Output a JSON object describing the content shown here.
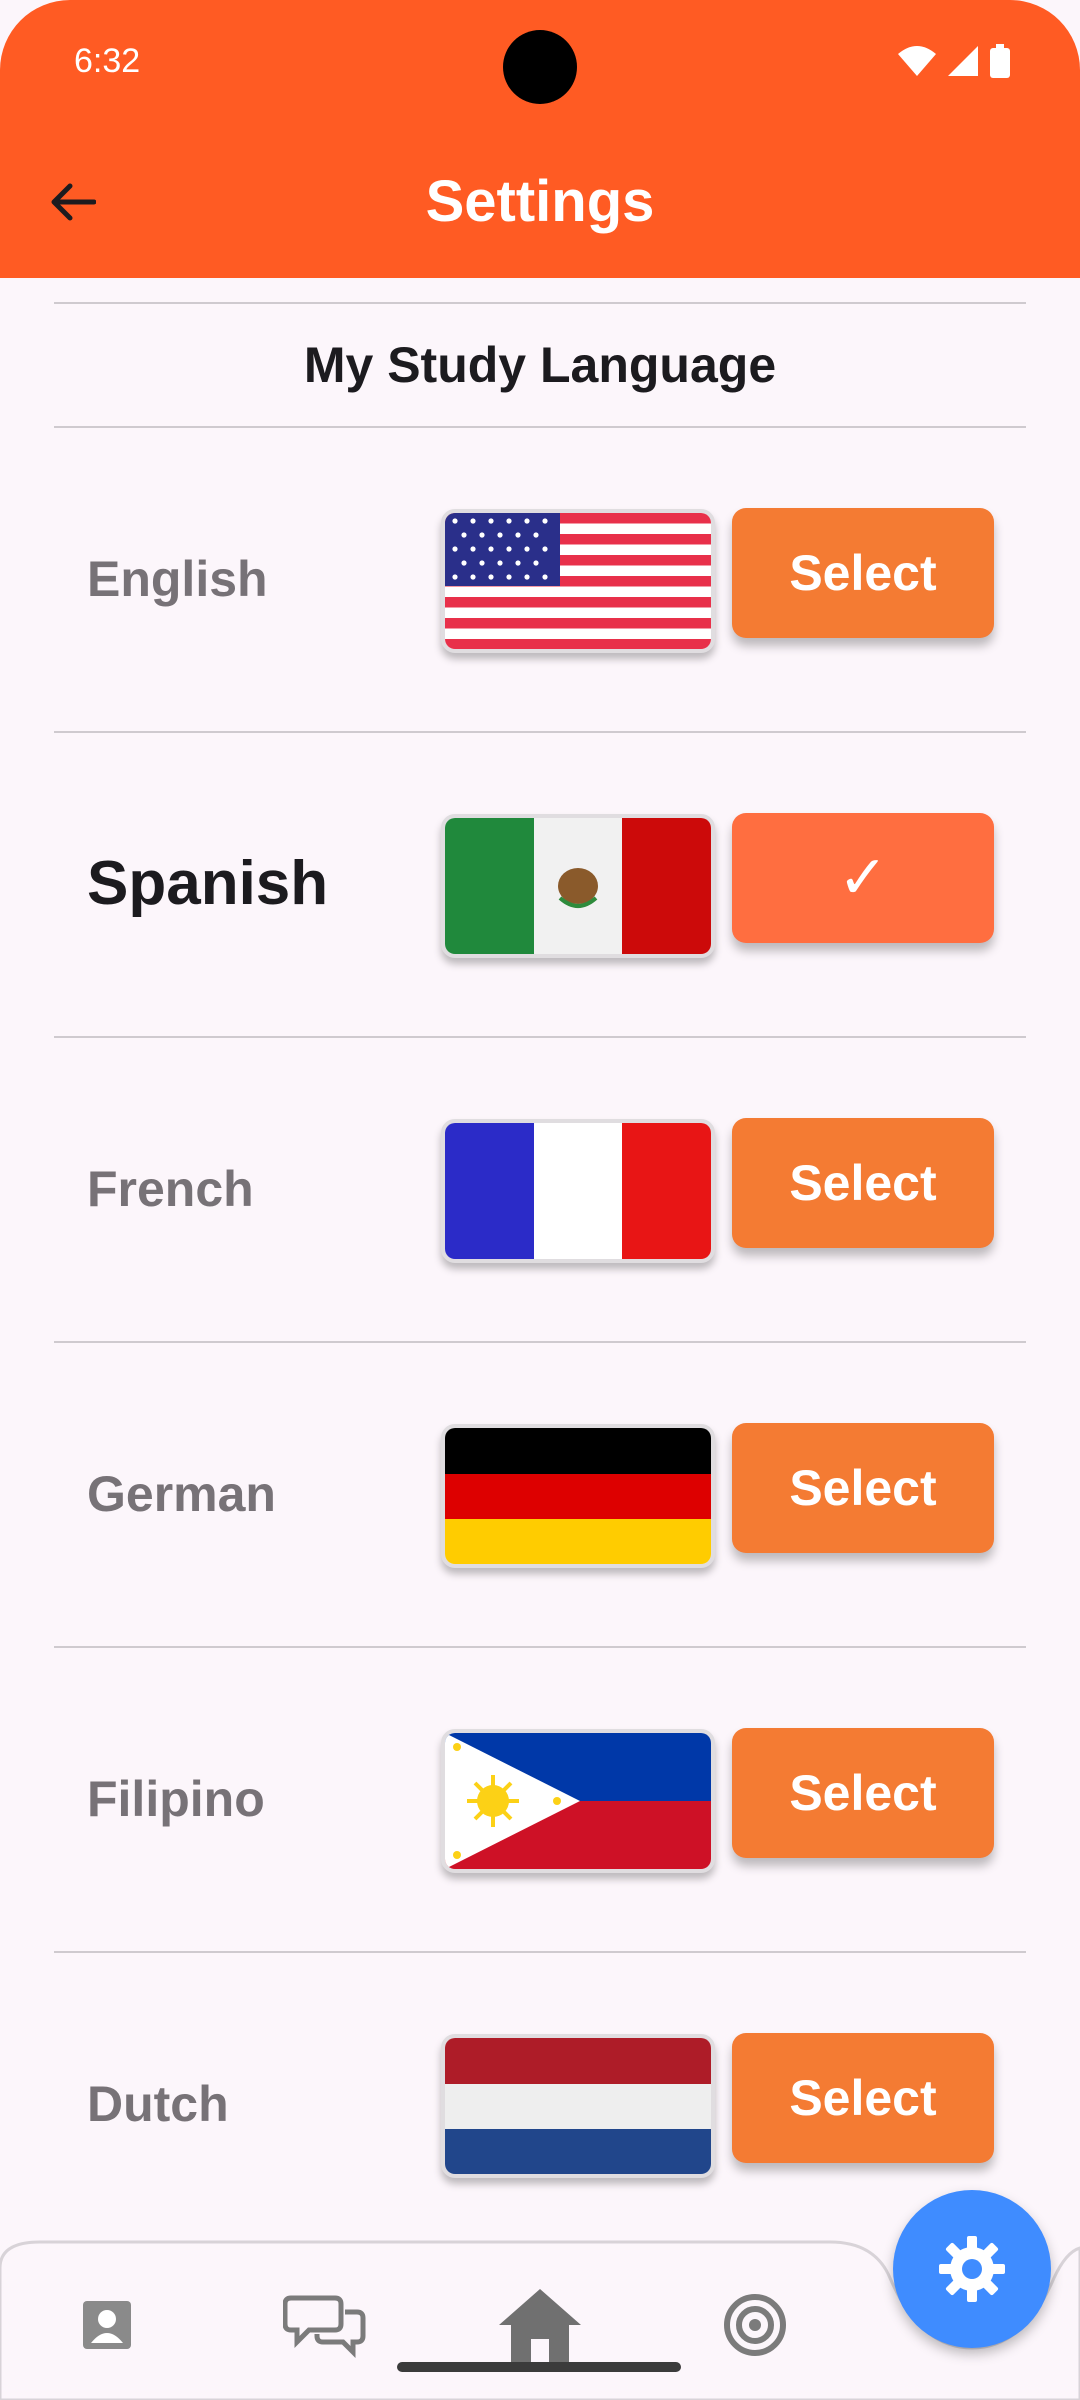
{
  "status_bar": {
    "time": "6:32"
  },
  "app_bar": {
    "title": "Settings"
  },
  "section": {
    "title": "My Study Language"
  },
  "languages": [
    {
      "name": "English",
      "button": "Select",
      "flag": "us-flag",
      "active": false
    },
    {
      "name": "Spanish",
      "button": "✓",
      "flag": "mexico-flag",
      "active": true
    },
    {
      "name": "French",
      "button": "Select",
      "flag": "france-flag",
      "active": false
    },
    {
      "name": "German",
      "button": "Select",
      "flag": "germany-flag",
      "active": false
    },
    {
      "name": "Filipino",
      "button": "Select",
      "flag": "philippines-flag",
      "active": false
    },
    {
      "name": "Dutch",
      "button": "Select",
      "flag": "netherlands-flag",
      "active": false
    }
  ],
  "bottom_nav": [
    {
      "icon": "profile-icon"
    },
    {
      "icon": "chat-icon"
    },
    {
      "icon": "home-icon"
    },
    {
      "icon": "target-icon"
    }
  ],
  "fab": {
    "icon": "gear-icon"
  },
  "colors": {
    "app_bar": "#ff5b23",
    "select_button": "#f47b33",
    "selected_button": "#ff6e40",
    "fab": "#3f8cff",
    "background": "#fcf6fb"
  }
}
